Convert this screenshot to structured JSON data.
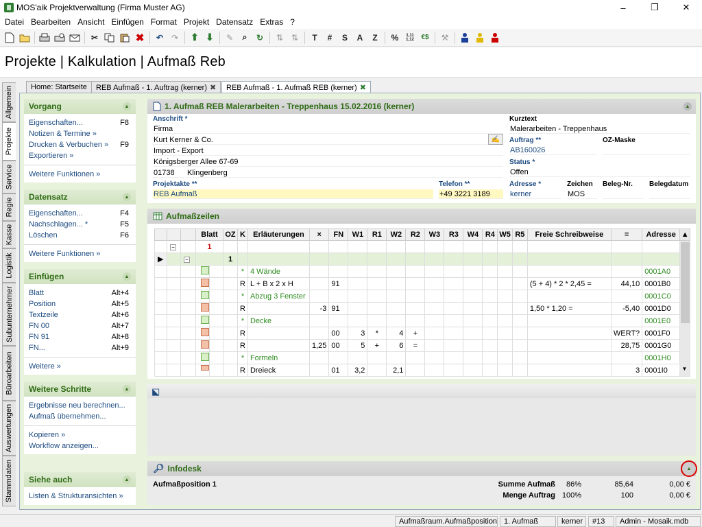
{
  "window": {
    "title": "MOS'aik Projektverwaltung (Firma Muster AG)"
  },
  "menu": [
    "Datei",
    "Bearbeiten",
    "Ansicht",
    "Einfügen",
    "Format",
    "Projekt",
    "Datensatz",
    "Extras",
    "?"
  ],
  "toolbar": {
    "text_buttons": [
      "T",
      "#",
      "S",
      "A",
      "Z",
      "%",
      "1,11\n1,12",
      "€$"
    ]
  },
  "header": {
    "title": "Projekte | Kalkulation | Aufmaß Reb"
  },
  "vtabs": [
    "Allgemein",
    "Projekte",
    "Service",
    "Regie",
    "Kasse",
    "Logistik",
    "Subunternehmer",
    "Büroarbeiten",
    "Auswertungen",
    "Stammdaten"
  ],
  "tabs": [
    {
      "label": "Home: Startseite"
    },
    {
      "label": "REB Aufmaß - 1. Auftrag (kerner)"
    },
    {
      "label": "REB Aufmaß - 1. Aufmaß REB (kerner)"
    }
  ],
  "sidebar": {
    "vorgang": {
      "title": "Vorgang",
      "items": [
        {
          "label": "Eigenschaften...",
          "key": "F8"
        },
        {
          "label": "Notizen & Termine »",
          "key": ""
        },
        {
          "label": "Drucken & Verbuchen »",
          "key": "F9"
        },
        {
          "label": "Exportieren »",
          "key": ""
        }
      ],
      "more": "Weitere Funktionen »"
    },
    "datensatz": {
      "title": "Datensatz",
      "items": [
        {
          "label": "Eigenschaften...",
          "key": "F4"
        },
        {
          "label": "Nachschlagen... *",
          "key": "F5"
        },
        {
          "label": "Löschen",
          "key": "F6"
        }
      ],
      "more": "Weitere Funktionen »"
    },
    "einfuegen": {
      "title": "Einfügen",
      "items": [
        {
          "label": "Blatt",
          "key": "Alt+4"
        },
        {
          "label": "Position",
          "key": "Alt+5"
        },
        {
          "label": "Textzeile",
          "key": "Alt+6"
        },
        {
          "label": "FN 00",
          "key": "Alt+7"
        },
        {
          "label": "FN 91",
          "key": "Alt+8"
        },
        {
          "label": "FN...",
          "key": "Alt+9"
        }
      ],
      "more": "Weitere »"
    },
    "schritte": {
      "title": "Weitere Schritte",
      "items": [
        "Ergebnisse neu berechnen...",
        "Aufmaß übernehmen..."
      ],
      "items2": [
        "Kopieren »",
        "Workflow anzeigen..."
      ]
    },
    "siehe": {
      "title": "Siehe auch",
      "items": [
        "Listen & Strukturansichten »"
      ]
    }
  },
  "form": {
    "title": "1. Aufmaß REB Malerarbeiten - Treppenhaus 15.02.2016 (kerner)",
    "anschrift_label": "Anschrift *",
    "anschrift": [
      "Firma",
      "Kurt Kerner & Co.",
      "Import - Export",
      "Königsberger Allee 67-69"
    ],
    "plz": "01738",
    "ort": "Klingenberg",
    "kurztext_label": "Kurztext",
    "kurztext": "Malerarbeiten - Treppenhaus",
    "auftrag_label": "Auftrag **",
    "auftrag": "AB160026",
    "ozmaske_label": "OZ-Maske",
    "ozmaske": "",
    "status_label": "Status *",
    "status": "Offen",
    "projektakte_label": "Projektakte **",
    "projektakte": "REB Aufmaß",
    "telefon_label": "Telefon **",
    "telefon": "+49 3221 3189",
    "adresse_label": "Adresse *",
    "adresse": "kerner",
    "zeichen_label": "Zeichen",
    "zeichen": "MOS",
    "belegnr_label": "Beleg-Nr.",
    "belegnr": "",
    "belegdatum_label": "Belegdatum",
    "belegdatum": ""
  },
  "aufmass": {
    "title": "Aufmaßzeilen",
    "columns": [
      "Blatt",
      "OZ",
      "K",
      "Erläuterungen",
      "×",
      "FN",
      "W1",
      "R1",
      "W2",
      "R2",
      "W3",
      "R3",
      "W4",
      "R4",
      "W5",
      "R5",
      "Freie Schreibweise",
      "=",
      "Adresse"
    ],
    "rows": [
      {
        "blatt": "1",
        "oz": "",
        "k": "",
        "erl": "",
        "x": "",
        "fn": "",
        "w1": "",
        "r1": "",
        "w2": "",
        "r2": "",
        "frei": "",
        "eq": "",
        "adr": ""
      },
      {
        "blatt": "",
        "oz": "1",
        "k": "",
        "erl": "",
        "x": "",
        "fn": "",
        "w1": "",
        "r1": "",
        "w2": "",
        "r2": "",
        "frei": "",
        "eq": "",
        "adr": ""
      },
      {
        "blatt": "",
        "oz": "",
        "k": "*",
        "erl": "4 Wände",
        "x": "",
        "fn": "",
        "w1": "",
        "r1": "",
        "w2": "",
        "r2": "",
        "frei": "",
        "eq": "",
        "adr": "0001A0"
      },
      {
        "blatt": "",
        "oz": "",
        "k": "R",
        "erl": "L + B x 2 x H",
        "x": "",
        "fn": "91",
        "w1": "",
        "r1": "",
        "w2": "",
        "r2": "",
        "frei": "(5 + 4) * 2 * 2,45 =",
        "eq": "44,10",
        "adr": "0001B0"
      },
      {
        "blatt": "",
        "oz": "",
        "k": "*",
        "erl": "Abzug 3 Fenster",
        "x": "",
        "fn": "",
        "w1": "",
        "r1": "",
        "w2": "",
        "r2": "",
        "frei": "",
        "eq": "",
        "adr": "0001C0"
      },
      {
        "blatt": "",
        "oz": "",
        "k": "R",
        "erl": "",
        "x": "-3",
        "fn": "91",
        "w1": "",
        "r1": "",
        "w2": "",
        "r2": "",
        "frei": "1,50 * 1,20 =",
        "eq": "-5,40",
        "adr": "0001D0"
      },
      {
        "blatt": "",
        "oz": "",
        "k": "*",
        "erl": "Decke",
        "x": "",
        "fn": "",
        "w1": "",
        "r1": "",
        "w2": "",
        "r2": "",
        "frei": "",
        "eq": "",
        "adr": "0001E0"
      },
      {
        "blatt": "",
        "oz": "",
        "k": "R",
        "erl": "",
        "x": "",
        "fn": "00",
        "w1": "3",
        "r1": "*",
        "w2": "4",
        "r2": "+",
        "frei": "",
        "eq": "WERT?",
        "adr": "0001F0"
      },
      {
        "blatt": "",
        "oz": "",
        "k": "R",
        "erl": "",
        "x": "1,25",
        "fn": "00",
        "w1": "5",
        "r1": "+",
        "w2": "6",
        "r2": "=",
        "frei": "",
        "eq": "28,75",
        "adr": "0001G0"
      },
      {
        "blatt": "",
        "oz": "",
        "k": "*",
        "erl": "Formeln",
        "x": "",
        "fn": "",
        "w1": "",
        "r1": "",
        "w2": "",
        "r2": "",
        "frei": "",
        "eq": "",
        "adr": "0001H0"
      },
      {
        "blatt": "",
        "oz": "",
        "k": "R",
        "erl": "Dreieck",
        "x": "",
        "fn": "01",
        "w1": "3,2",
        "r1": "",
        "w2": "2,1",
        "r2": "",
        "frei": "",
        "eq": "3",
        "adr": "0001I0"
      }
    ]
  },
  "infodesk": {
    "title": "Infodesk",
    "position": "Aufmaßposition 1",
    "summe_label": "Summe Aufmaß",
    "summe_pct": "86%",
    "summe_val": "85,64",
    "summe_eur": "0,00 €",
    "menge_label": "Menge Auftrag",
    "menge_pct": "100%",
    "menge_val": "100",
    "menge_eur": "0,00 €"
  },
  "statusbar": [
    "Aufmaßraum.Aufmaßposition",
    "1. Aufmaß REB",
    "kerner",
    "#13",
    "Admin - Mosaik.mdb"
  ]
}
